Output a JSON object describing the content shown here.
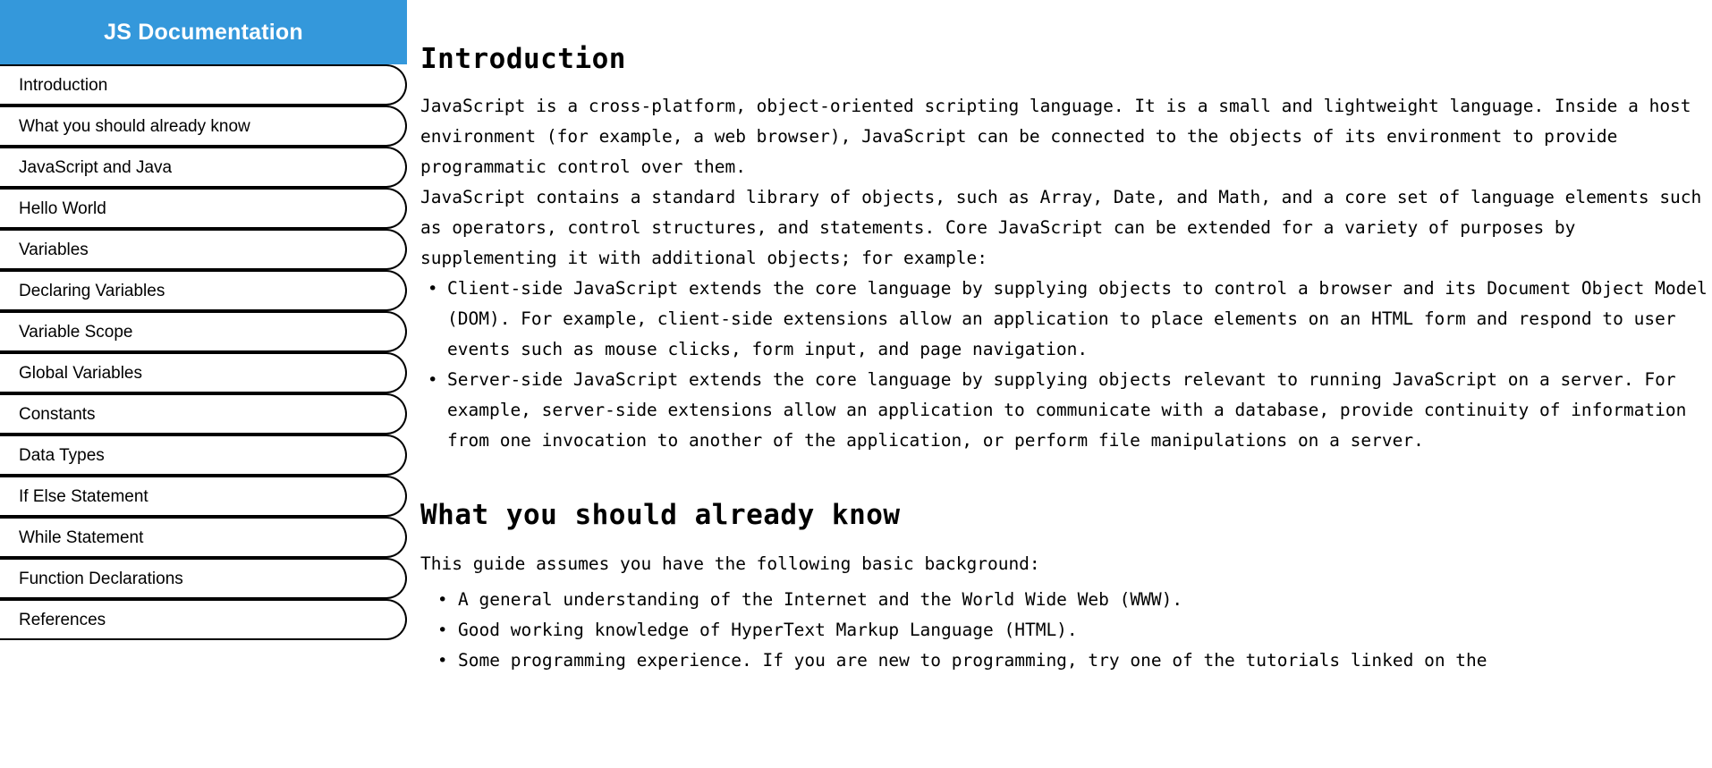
{
  "sidebar": {
    "title": "JS Documentation",
    "items": [
      {
        "label": "Introduction"
      },
      {
        "label": "What you should already know"
      },
      {
        "label": "JavaScript and Java"
      },
      {
        "label": "Hello World"
      },
      {
        "label": "Variables"
      },
      {
        "label": "Declaring Variables"
      },
      {
        "label": "Variable Scope"
      },
      {
        "label": "Global Variables"
      },
      {
        "label": "Constants"
      },
      {
        "label": "Data Types"
      },
      {
        "label": "If Else Statement"
      },
      {
        "label": "While Statement"
      },
      {
        "label": "Function Declarations"
      },
      {
        "label": "References"
      }
    ],
    "header_bg": "#3498db",
    "header_text_color": "#ffffff"
  },
  "main": {
    "sections": [
      {
        "id": "introduction",
        "header": "Introduction",
        "paragraphs": [
          "JavaScript is a cross-platform, object-oriented scripting language. It is a small and lightweight language. Inside a host environment (for example, a web browser), JavaScript can be connected to the objects of its environment to provide programmatic control over them.",
          "JavaScript contains a standard library of objects, such as Array, Date, and Math, and a core set of language elements such as operators, control structures, and statements. Core JavaScript can be extended for a variety of purposes by supplementing it with additional objects; for example:"
        ],
        "bullets": [
          "Client-side JavaScript extends the core language by supplying objects to control a browser and its Document Object Model (DOM). For example, client-side extensions allow an application to place elements on an HTML form and respond to user events such as mouse clicks, form input, and page navigation.",
          "Server-side JavaScript extends the core language by supplying objects relevant to running JavaScript on a server. For example, server-side extensions allow an application to communicate with a database, provide continuity of information from one invocation to another of the application, or perform file manipulations on a server."
        ]
      },
      {
        "id": "what-you-should-already-know",
        "header": "What you should already know",
        "paragraphs": [
          "This guide assumes you have the following basic background:"
        ],
        "bullets": [
          "A general understanding of the Internet and the World Wide Web (WWW).",
          "Good working knowledge of HyperText Markup Language (HTML).",
          "Some programming experience. If you are new to programming, try one of the tutorials linked on the"
        ]
      }
    ]
  }
}
